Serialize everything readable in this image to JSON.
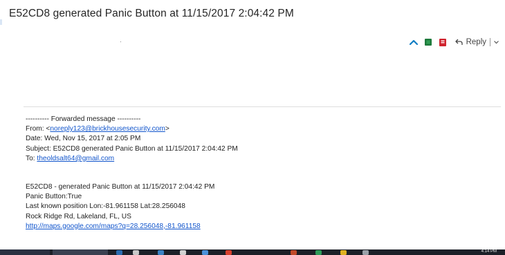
{
  "email": {
    "subject": "E52CD8 generated Panic Button at 11/15/2017 2:04:42 PM"
  },
  "toolbar": {
    "collapse_icon": "chevron-up-icon",
    "green_icon": "green-square-icon",
    "red_icon": "red-square-icon",
    "reply_label": "Reply",
    "reply_icon": "reply-arrow-icon",
    "reply_dropdown_icon": "chevron-down-icon"
  },
  "forwarded": {
    "header_line": "---------- Forwarded message ----------",
    "from_label": "From: <",
    "from_email": "noreply123@brickhousesecurity.com",
    "from_suffix": ">",
    "date_line": "Date: Wed, Nov 15, 2017 at 2:05 PM",
    "subject_line": "Subject: E52CD8 generated Panic Button at 11/15/2017 2:04:42 PM",
    "to_label": "To: ",
    "to_email": "theoldsalt64@gmail.com"
  },
  "message": {
    "line1": "E52CD8 -   generated Panic Button at 11/15/2017  2:04:42 PM",
    "line2": "Panic Button:True",
    "line3": "Last known position Lon:-81.961158 Lat:28.256048",
    "line4": "Rock Ridge Rd, Lakeland, FL, US",
    "map_link": "http://maps.google.com/maps?q=28.256048,-81.961158"
  },
  "taskbar": {
    "clock": "4:14 PM"
  },
  "colors": {
    "link": "#1155cc",
    "collapse_icon": "#0f7dc4",
    "green_icon": "#1e7a3c",
    "red_icon": "#d0242f",
    "taskbar": "#1c2028"
  }
}
